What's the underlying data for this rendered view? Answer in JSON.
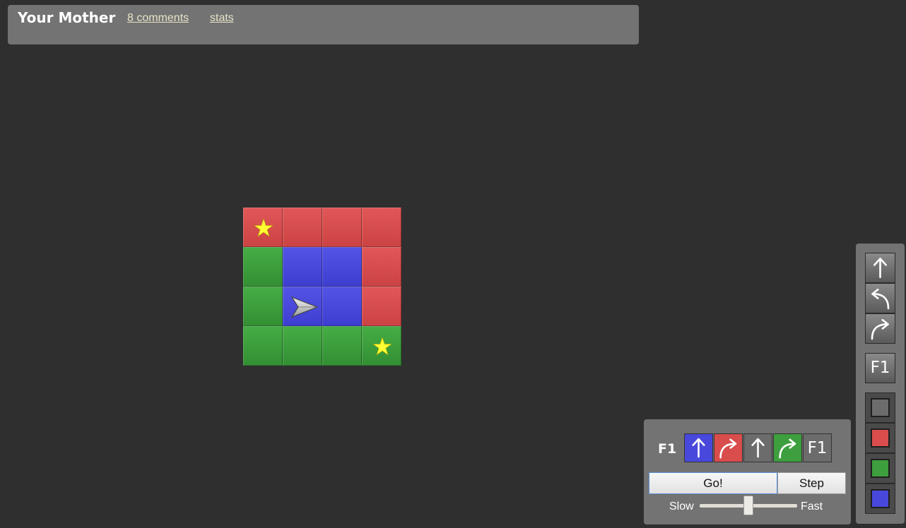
{
  "header": {
    "title": "Your Mother",
    "comments_link": "8 comments",
    "stats_link": "stats"
  },
  "board": {
    "rows": [
      [
        "red",
        "red",
        "red",
        "red"
      ],
      [
        "green",
        "blue",
        "blue",
        "red"
      ],
      [
        "green",
        "blue",
        "blue",
        "red"
      ],
      [
        "green",
        "green",
        "green",
        "green"
      ]
    ],
    "stars": [
      [
        0,
        0
      ],
      [
        3,
        3
      ]
    ],
    "ship": {
      "row": 2,
      "col": 1,
      "direction": "right"
    }
  },
  "program": {
    "function_label": "F1",
    "slots": [
      {
        "action": "forward",
        "condition": "blue"
      },
      {
        "action": "turn-right",
        "condition": "red"
      },
      {
        "action": "forward",
        "condition": "gray"
      },
      {
        "action": "turn-right",
        "condition": "green"
      },
      {
        "action": "call-f1",
        "label": "F1",
        "condition": "gray"
      }
    ],
    "go_label": "Go!",
    "step_label": "Step",
    "slow_label": "Slow",
    "fast_label": "Fast",
    "speed_fraction": 0.5
  },
  "toolbox": {
    "actions": [
      "forward",
      "turn-left",
      "turn-right"
    ],
    "function_label": "F1",
    "conditions": [
      "gray",
      "red",
      "green",
      "blue"
    ]
  },
  "colors": {
    "background": "#2f2f2f",
    "panel": "#737373",
    "red": "#d94d4d",
    "green": "#3d9f3d",
    "blue": "#4848dc",
    "gray": "#6c6c6c",
    "star": "#ffff33",
    "link": "#e8e3c6"
  }
}
